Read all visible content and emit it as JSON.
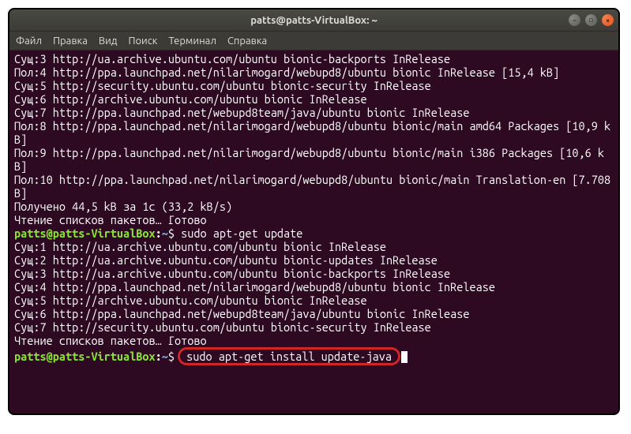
{
  "window": {
    "title": "patts@patts-VirtualBox: ~"
  },
  "menu": {
    "file": "Файл",
    "edit": "Правка",
    "view": "Вид",
    "search": "Поиск",
    "terminal": "Терминал",
    "help": "Справка"
  },
  "prompt": {
    "user_host": "patts@patts-VirtualBox",
    "colon": ":",
    "path": "~",
    "dollar": "$"
  },
  "lines": {
    "l0": "Сущ:3 http://ua.archive.ubuntu.com/ubuntu bionic-backports InRelease",
    "l1": "Пол:4 http://ppa.launchpad.net/nilarimogard/webupd8/ubuntu bionic InRelease [15,4 kB]",
    "l2": "Сущ:5 http://security.ubuntu.com/ubuntu bionic-security InRelease",
    "l3": "Сущ:6 http://archive.ubuntu.com/ubuntu bionic InRelease",
    "l4": "Сущ:7 http://ppa.launchpad.net/webupd8team/java/ubuntu bionic InRelease",
    "l5": "Пол:8 http://ppa.launchpad.net/nilarimogard/webupd8/ubuntu bionic/main amd64 Packages [10,9 kB]",
    "l6": "Пол:9 http://ppa.launchpad.net/nilarimogard/webupd8/ubuntu bionic/main i386 Packages [10,6 kB]",
    "l7": "Пол:10 http://ppa.launchpad.net/nilarimogard/webupd8/ubuntu bionic/main Translation-en [7.708 B]",
    "l8": "Получено 44,5 kB за 1с (33,2 kB/s)",
    "l9": "Чтение списков пакетов… Готово",
    "cmd1": " sudo apt-get update",
    "l10": "Сущ:1 http://ua.archive.ubuntu.com/ubuntu bionic InRelease",
    "l11": "Сущ:2 http://ua.archive.ubuntu.com/ubuntu bionic-updates InRelease",
    "l12": "Сущ:3 http://ua.archive.ubuntu.com/ubuntu bionic-backports InRelease",
    "l13": "Сущ:4 http://ppa.launchpad.net/nilarimogard/webupd8/ubuntu bionic InRelease",
    "l14": "Сущ:5 http://archive.ubuntu.com/ubuntu bionic InRelease",
    "l15": "Сущ:6 http://ppa.launchpad.net/webupd8team/java/ubuntu bionic InRelease",
    "l16": "Сущ:7 http://security.ubuntu.com/ubuntu bionic-security InRelease",
    "l17": "Чтение списков пакетов… Готово",
    "cmd2": "sudo apt-get install update-java"
  }
}
